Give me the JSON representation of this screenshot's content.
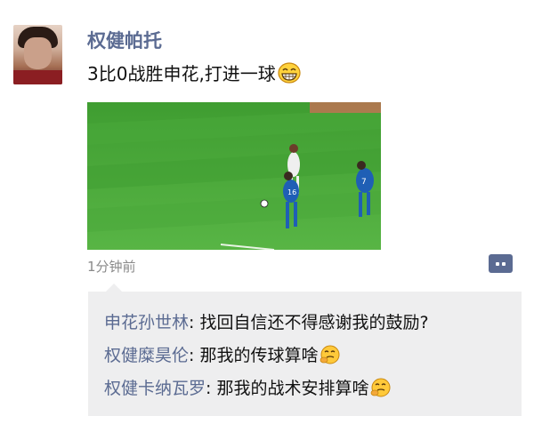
{
  "post": {
    "username": "权健帕托",
    "text": "3比0战胜申花,打进一球",
    "time": "1分钟前"
  },
  "comments": [
    {
      "name": "申花孙世林",
      "separator": ": ",
      "text": "找回自信还不得感谢我的鼓励?"
    },
    {
      "name": "权健糜昊伦",
      "separator": ": ",
      "text": "那我的传球算啥"
    },
    {
      "name": "权健卡纳瓦罗",
      "separator": ": ",
      "text": "那我的战术安排算啥"
    }
  ],
  "icons": {
    "post_emoji": "grin-icon",
    "comment_emoji": "thinking-face-icon",
    "comment_button": "comment-icon"
  },
  "colors": {
    "name_link": "#5b6b92",
    "comment_bg": "#eeeeef",
    "time": "#8a8a8a"
  }
}
